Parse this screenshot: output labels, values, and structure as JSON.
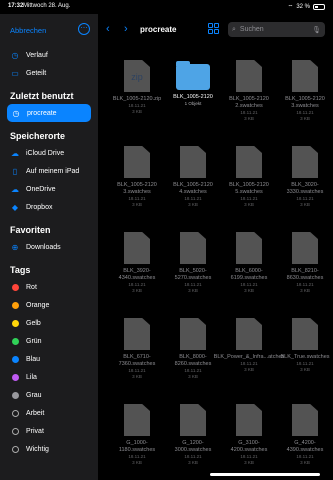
{
  "status": {
    "time": "17:32",
    "date": "Mittwoch 28. Aug.",
    "right": "32 %"
  },
  "sidebar": {
    "cancel": "Abbrechen",
    "sections": [
      {
        "title": "",
        "items": [
          {
            "label": "Verlauf",
            "icon": "clock-icon"
          },
          {
            "label": "Geteilt",
            "icon": "shared-folder-icon"
          }
        ]
      },
      {
        "title": "Zuletzt benutzt",
        "items": [
          {
            "label": "procreate",
            "icon": "clock-icon",
            "active": true
          }
        ]
      },
      {
        "title": "Speicherorte",
        "items": [
          {
            "label": "iCloud Drive",
            "icon": "cloud-icon"
          },
          {
            "label": "Auf meinem iPad",
            "icon": "ipad-icon"
          },
          {
            "label": "OneDrive",
            "icon": "onedrive-icon"
          },
          {
            "label": "Dropbox",
            "icon": "dropbox-icon"
          }
        ]
      },
      {
        "title": "Favoriten",
        "items": [
          {
            "label": "Downloads",
            "icon": "download-icon"
          }
        ]
      },
      {
        "title": "Tags",
        "items": [
          {
            "label": "Rot",
            "color": "#ff453a"
          },
          {
            "label": "Orange",
            "color": "#ff9f0a"
          },
          {
            "label": "Gelb",
            "color": "#ffd60a"
          },
          {
            "label": "Grün",
            "color": "#30d158"
          },
          {
            "label": "Blau",
            "color": "#0a84ff"
          },
          {
            "label": "Lila",
            "color": "#bf5af2"
          },
          {
            "label": "Grau",
            "color": "#98989d"
          },
          {
            "label": "Arbeit",
            "color": ""
          },
          {
            "label": "Privat",
            "color": ""
          },
          {
            "label": "Wichtig",
            "color": ""
          }
        ]
      }
    ]
  },
  "toolbar": {
    "title": "procreate",
    "search_placeholder": "Suchen"
  },
  "files": [
    {
      "name": "BLK_1005-2120.zip",
      "type": "zip",
      "date": "18.11.21",
      "size": "3 KB"
    },
    {
      "name": "BLK_1005-2120",
      "type": "folder",
      "date": "",
      "size": "1 Objekt"
    },
    {
      "name": "BLK_1005-2120 2.swatches",
      "type": "file",
      "date": "18.11.21",
      "size": "3 KB"
    },
    {
      "name": "BLK_1005-2120 3.swatches",
      "type": "file",
      "date": "18.11.21",
      "size": "3 KB"
    },
    {
      "name": "BLK_1005-2120 3.swatches",
      "type": "file",
      "date": "18.11.21",
      "size": "3 KB"
    },
    {
      "name": "BLK_1005-2120 4.swatches",
      "type": "file",
      "date": "18.11.21",
      "size": "3 KB"
    },
    {
      "name": "BLK_1005-2120 5.swatches",
      "type": "file",
      "date": "18.11.21",
      "size": "3 KB"
    },
    {
      "name": "BLK_3020-3330.swatches",
      "type": "file",
      "date": "18.11.21",
      "size": "3 KB"
    },
    {
      "name": "BLK_3920-4340.swatches",
      "type": "file",
      "date": "18.11.21",
      "size": "3 KB"
    },
    {
      "name": "BLK_5020-5270.swatches",
      "type": "file",
      "date": "18.11.21",
      "size": "3 KB"
    },
    {
      "name": "BLK_6000-6199.swatches",
      "type": "file",
      "date": "18.11.21",
      "size": "3 KB"
    },
    {
      "name": "BLK_8210-8630.swatches",
      "type": "file",
      "date": "18.11.21",
      "size": "3 KB"
    },
    {
      "name": "BLK_6710-7360.swatches",
      "type": "file",
      "date": "18.11.21",
      "size": "3 KB"
    },
    {
      "name": "BLK_8000-8260.swatches",
      "type": "file",
      "date": "18.11.21",
      "size": "3 KB"
    },
    {
      "name": "BLK_Power_&_Infra...atches",
      "type": "file",
      "date": "18.11.21",
      "size": "3 KB"
    },
    {
      "name": "BLK_True.swatches",
      "type": "file",
      "date": "18.11.21",
      "size": "3 KB"
    },
    {
      "name": "G_1000-1180.swatches",
      "type": "file",
      "date": "18.11.21",
      "size": "3 KB"
    },
    {
      "name": "G_1200-3000.swatches",
      "type": "file",
      "date": "18.11.21",
      "size": "3 KB"
    },
    {
      "name": "G_3100-4200.swatches",
      "type": "file",
      "date": "18.11.21",
      "size": "3 KB"
    },
    {
      "name": "G_4200-4390.swatches",
      "type": "file",
      "date": "18.11.21",
      "size": "3 KB"
    }
  ]
}
